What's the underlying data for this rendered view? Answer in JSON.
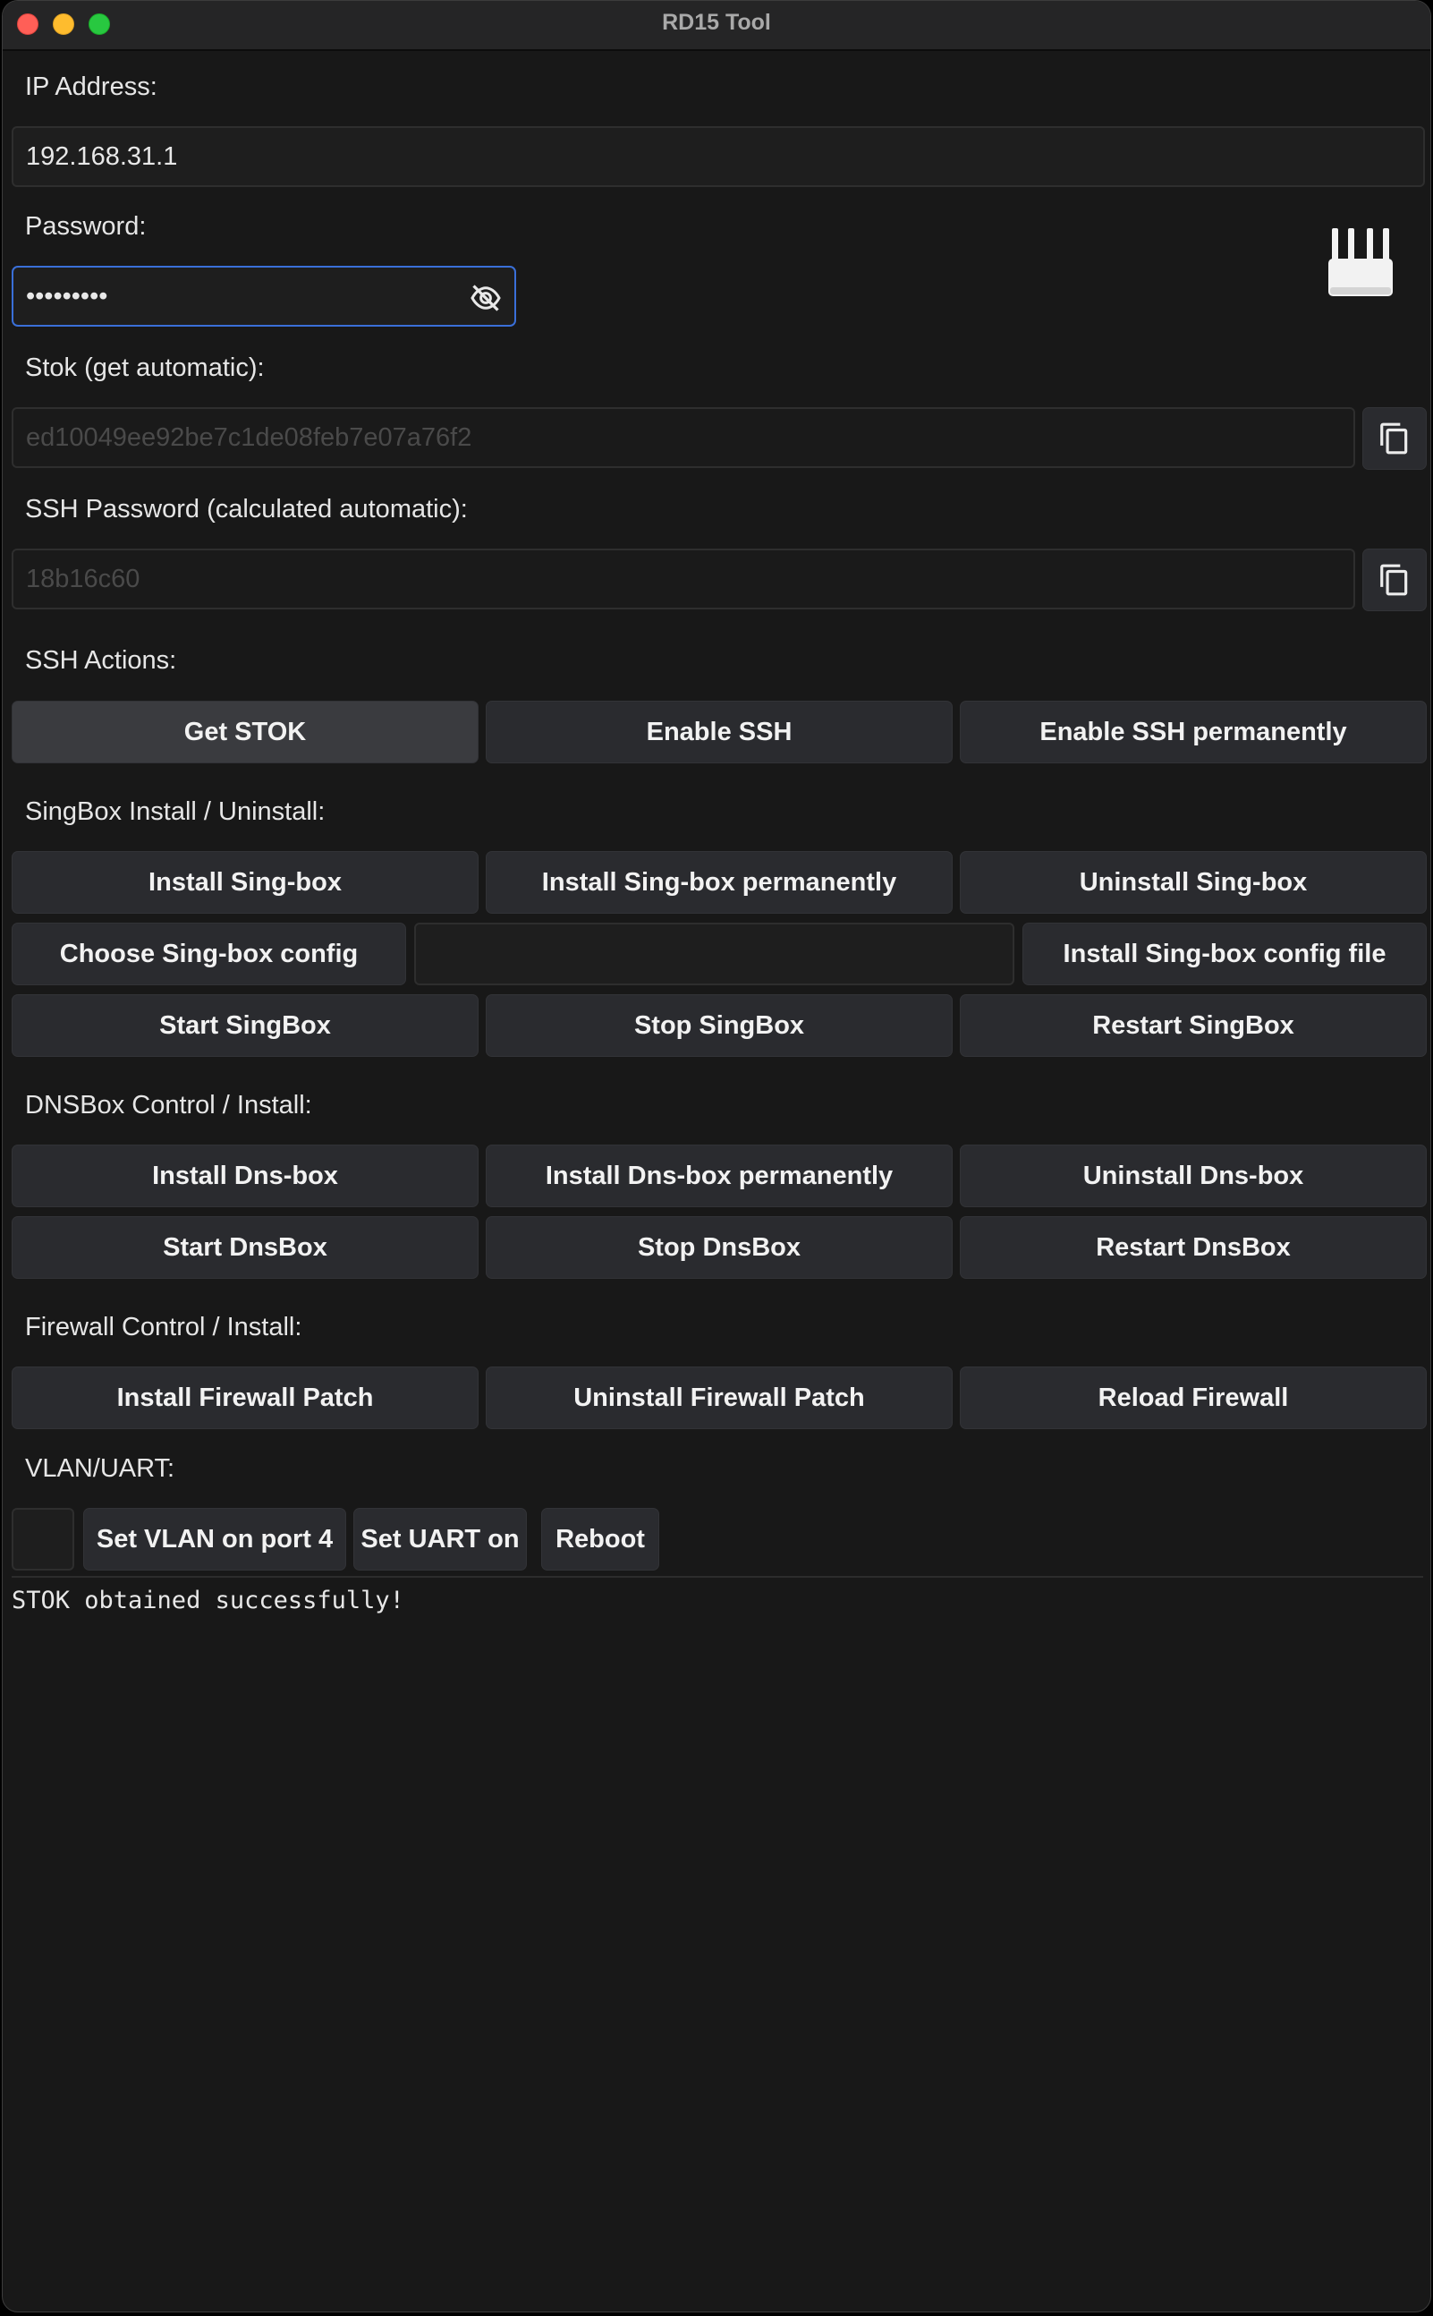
{
  "window": {
    "title": "RD15 Tool"
  },
  "connection": {
    "ip_label": "IP Address:",
    "ip_value": "192.168.31.1",
    "password_label": "Password:",
    "password_value": "•••••••••",
    "stok_label": "Stok (get automatic):",
    "stok_value": "ed10049ee92be7c1de08feb7e07a76f2",
    "ssh_password_label": "SSH Password (calculated automatic):",
    "ssh_password_value": "18b16c60"
  },
  "ssh_actions": {
    "label": "SSH Actions:",
    "buttons": [
      "Get STOK",
      "Enable SSH",
      "Enable SSH permanently"
    ]
  },
  "singbox": {
    "label": "SingBox Install / Uninstall:",
    "install_buttons": [
      "Install Sing-box",
      "Install Sing-box permanently",
      "Uninstall Sing-box"
    ],
    "choose_config": "Choose Sing-box config",
    "config_path": "",
    "install_config": "Install Sing-box config file",
    "control_buttons": [
      "Start SingBox",
      "Stop SingBox",
      "Restart SingBox"
    ]
  },
  "dnsbox": {
    "label": "DNSBox Control / Install:",
    "install_buttons": [
      "Install Dns-box",
      "Install Dns-box permanently",
      "Uninstall Dns-box"
    ],
    "control_buttons": [
      "Start DnsBox",
      "Stop DnsBox",
      "Restart DnsBox"
    ]
  },
  "firewall": {
    "label": "Firewall Control / Install:",
    "buttons": [
      "Install Firewall Patch",
      "Uninstall Firewall Patch",
      "Reload Firewall"
    ]
  },
  "vlan_uart": {
    "label": "VLAN/UART:",
    "port_value": "",
    "set_vlan": "Set VLAN on port 4",
    "set_uart": "Set UART on",
    "reboot": "Reboot"
  },
  "console": {
    "log": "STOK obtained successfully!"
  },
  "icons": {
    "password_toggle": "eye-off-icon",
    "copy": "copy-icon",
    "router": "router-icon"
  },
  "colors": {
    "focus_border": "#3a6fd8",
    "button_bg": "#2a2b2f",
    "window_bg": "#181818"
  }
}
